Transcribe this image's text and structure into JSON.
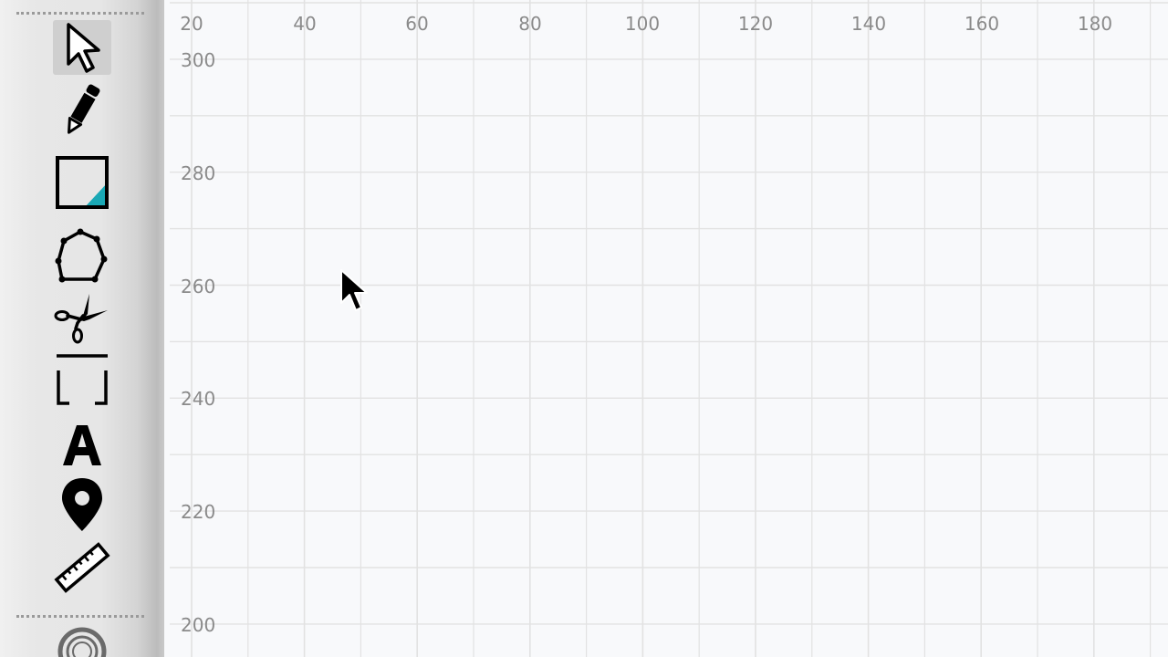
{
  "toolbar": {
    "tools": [
      {
        "name": "select",
        "icon": "arrow-cursor-icon",
        "active": true
      },
      {
        "name": "pencil",
        "icon": "pencil-icon",
        "active": false
      },
      {
        "name": "rectangle",
        "icon": "rectangle-icon",
        "active": false
      },
      {
        "name": "polygon",
        "icon": "polygon-icon",
        "active": false
      },
      {
        "name": "cut",
        "icon": "scissors-icon",
        "active": false
      },
      {
        "name": "crop",
        "icon": "crop-icon",
        "active": false
      },
      {
        "name": "text",
        "icon": "text-a-icon",
        "active": false
      },
      {
        "name": "marker",
        "icon": "map-pin-icon",
        "active": false
      },
      {
        "name": "measure",
        "icon": "ruler-icon",
        "active": false
      },
      {
        "name": "more",
        "icon": "partial-circle-icon",
        "active": false
      }
    ],
    "accent_color": "#1aa8b5"
  },
  "canvas": {
    "x_ticks": [
      "20",
      "40",
      "60",
      "80",
      "100",
      "120",
      "140",
      "160",
      "180"
    ],
    "y_ticks": [
      "300",
      "280",
      "260",
      "240",
      "220",
      "200"
    ],
    "grid_color": "#e2e2e2",
    "label_color": "#8a8a8a"
  }
}
